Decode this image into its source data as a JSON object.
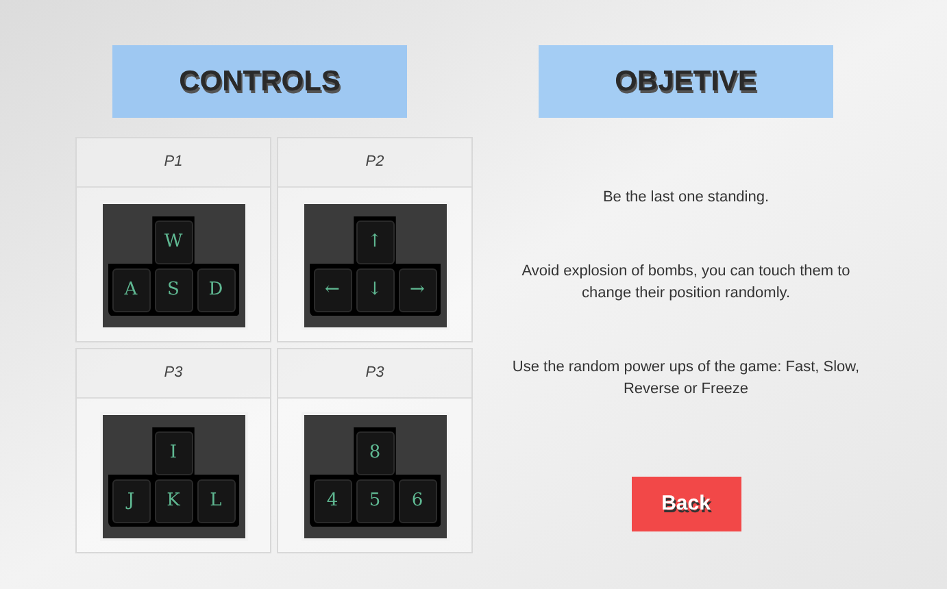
{
  "controls": {
    "title": "CONTROLS",
    "players": [
      {
        "label": "P1",
        "keys": [
          "W",
          "A",
          "S",
          "D"
        ]
      },
      {
        "label": "P2",
        "keys": [
          "↑",
          "←",
          "↓",
          "→"
        ]
      },
      {
        "label": "P3",
        "keys": [
          "I",
          "J",
          "K",
          "L"
        ]
      },
      {
        "label": "P3",
        "keys": [
          "8",
          "4",
          "5",
          "6"
        ]
      }
    ]
  },
  "objective": {
    "title": "OBJETIVE",
    "lines": [
      "Be the last one standing.",
      "Avoid explosion of bombs, you can touch them to change their position randomly.",
      "Use the random power ups of the game: Fast, Slow, Reverse or Freeze"
    ]
  },
  "back_button": "Back"
}
